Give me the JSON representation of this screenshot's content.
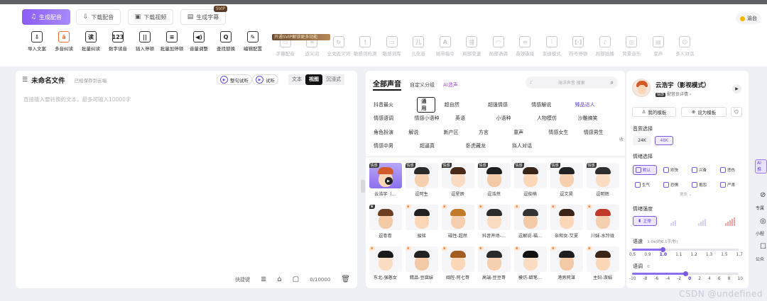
{
  "top_tabs": [
    {
      "label": "生成配音",
      "icon": "♫",
      "active": true
    },
    {
      "label": "下载配音",
      "icon": "⇩"
    },
    {
      "label": "下载视频",
      "icon": "▣"
    },
    {
      "label": "生成字幕",
      "icon": "▤"
    }
  ],
  "svip_tag": "SVIP",
  "user_pill": "渝台",
  "tools": [
    {
      "label": "导入文案",
      "icon": "⇩"
    },
    {
      "label": "多音纠读",
      "icon": "ā"
    },
    {
      "label": "批量纠读",
      "icon": "读"
    },
    {
      "label": "数字读音",
      "icon": "123"
    },
    {
      "label": "插入停顿",
      "icon": "||"
    },
    {
      "label": "批量加停顿",
      "icon": "≡"
    },
    {
      "label": "音量调整",
      "icon": "◀)"
    },
    {
      "label": "查找替换",
      "icon": "Q"
    },
    {
      "label": "编辑配置",
      "icon": "✎"
    }
  ],
  "svip_banner": "开通SVIP解锁更多功能",
  "svip_tools": [
    {
      "label": "字幕配音",
      "icon": "▭"
    },
    {
      "label": "近义词",
      "icon": "≈"
    },
    {
      "label": "全文近义词",
      "icon": "↻"
    },
    {
      "label": "敏感词检测",
      "icon": "!"
    },
    {
      "label": "敏感词库",
      "icon": "▭"
    },
    {
      "label": "儿化音",
      "icon": "儿"
    },
    {
      "label": "插带指令",
      "icon": "A"
    },
    {
      "label": "局部变速",
      "icon": "⇶"
    },
    {
      "label": "局部语调",
      "icon": "◠"
    },
    {
      "label": "音效连接",
      "icon": "∞"
    },
    {
      "label": "变速模式",
      "icon": "⫶"
    },
    {
      "label": "符号停顿",
      "icon": "[·]"
    },
    {
      "label": "局部插播",
      "icon": "♪"
    },
    {
      "label": "背景音乐",
      "icon": "◎"
    },
    {
      "label": "变声",
      "icon": "▤"
    },
    {
      "label": "多人对话",
      "icon": "☺"
    }
  ],
  "editor": {
    "title": "未命名文件",
    "save_status": "已经保存到云端",
    "preview_all": "整句试听",
    "preview": "试听",
    "view_modes": [
      "文本",
      "视图",
      "沉浸式"
    ],
    "active_view": 1,
    "placeholder": "直接输入要转换的文本，最多可输入10000字",
    "footer_shortcut": "快捷键",
    "counter": "0/10000"
  },
  "voice_panel": {
    "tab_all": "全部声音",
    "tab_custom": "自定义分组",
    "tab_ai": "AI造声",
    "search_placeholder": "海洋声音 搜索",
    "collapse": "收",
    "tag_rows": [
      [
        "抖音最火",
        "通用",
        "超自然",
        "超强情感",
        "情感解说",
        "臻品达人"
      ],
      [
        "情感语调",
        "情感小语种",
        "英语",
        "小语种",
        "人物模仿",
        "沙雕搞笑"
      ],
      [
        "角色扮演",
        "解说",
        "新产区",
        "方言",
        "童声",
        "情感女生",
        "情感男生"
      ],
      [
        "情感中男",
        "超逼真",
        "卧虎藏龙",
        "拟人对话"
      ]
    ],
    "voices": [
      {
        "name": "云浩宇（…",
        "badge": "情感",
        "badge_type": "dark",
        "selected": true,
        "hair": "#d35b2a"
      },
      {
        "name": "逗阿生",
        "badge": "情感",
        "badge_type": "dark",
        "hair": "#2b2b2b"
      },
      {
        "name": "逗星辰",
        "badge": "情感",
        "badge_type": "dark",
        "hair": "#4a2a18"
      },
      {
        "name": "逗浩然",
        "badge": "情感",
        "badge_type": "dark",
        "hair": "#1f1f1f"
      },
      {
        "name": "逗俊楠",
        "badge": "情感",
        "badge_type": "dark",
        "hair": "#3a2618"
      },
      {
        "name": "逗文昊",
        "badge": "情感",
        "badge_type": "dark",
        "hair": "#222"
      },
      {
        "name": "逗明辉",
        "badge": "情感",
        "badge_type": "dark",
        "hair": "#2e2e2e"
      },
      {
        "name": "逗卷卷",
        "badge": "♛",
        "badge_type": "dark",
        "hair": "#6b3e1f"
      },
      {
        "name": "骏铭",
        "badge": "♛",
        "badge_type": "crown",
        "hair": "#222"
      },
      {
        "name": "磁性-超然",
        "badge": "♛",
        "badge_type": "crown",
        "hair": "#c07a2a"
      },
      {
        "name": "抖音开场-…",
        "badge": "♛",
        "badge_type": "crown",
        "hair": "#2b2b2b"
      },
      {
        "name": "逗解说-福…",
        "badge": "♛",
        "badge_type": "crown",
        "hair": "#333"
      },
      {
        "name": "亲和女-艾夏",
        "badge": "♛",
        "badge_type": "crown",
        "hair": "#3b2216"
      },
      {
        "name": "川妹-水玲珑",
        "badge": "♛",
        "badge_type": "crown",
        "hair": "#c0392b"
      },
      {
        "name": "东北-强憨女",
        "badge": "♛",
        "badge_type": "crown",
        "hair": "#1a1a1a"
      },
      {
        "name": "精品-豆腐妹",
        "badge": "♛",
        "badge_type": "crown",
        "hair": "#222"
      },
      {
        "name": "闽腔-阿七哥",
        "badge": "♛",
        "badge_type": "crown",
        "hair": "#a35d22"
      },
      {
        "name": "高端-豆豆哥",
        "badge": "♛",
        "badge_type": "crown",
        "hair": "#2a2a2a"
      },
      {
        "name": "模仿-蜡笔…",
        "badge": "♛",
        "badge_type": "crown",
        "hair": "#111"
      },
      {
        "name": "港男阿湛",
        "badge": "♛",
        "badge_type": "crown",
        "hair": "#1e1e1e"
      },
      {
        "name": "主妇-淑娟",
        "badge": "♛",
        "badge_type": "crown",
        "hair": "#3c2416"
      }
    ]
  },
  "detail": {
    "name": "云浩宇（影视模式）",
    "sub": "配音员详情",
    "sub_tag": "情感",
    "my_templates": "我的模板",
    "set_template": "设为模板",
    "quality_label": "音质选择",
    "quality": [
      "24K",
      "48K"
    ],
    "quality_active": 1,
    "emotion_label": "情绪选择",
    "emotions": [
      "默认",
      "欢快",
      "兴奋",
      "悲伤",
      "生气",
      "恐惧",
      "抱怨",
      "严肃"
    ],
    "more": "更多",
    "intensity_label": "情绪强度",
    "intensity_active": "正常",
    "speed_label": "语速",
    "speed_value": "1.0x(约6.1字/秒)",
    "speed_scale": [
      "0.5",
      "0.9",
      "1.0",
      "1.1",
      "1.2",
      "1.3",
      "1.5",
      "1.7"
    ],
    "speed_current": 1.0,
    "pitch_label": "语调",
    "pitch_value": "0",
    "pitch_scale": [
      "-10",
      "-8",
      "-6",
      "-4",
      "-2",
      "0",
      "2",
      "4",
      "6",
      "8",
      "10"
    ],
    "pitch_current": 0
  },
  "side_edge": {
    "ai_tag": "AI推",
    "items": [
      "专属",
      "小程",
      "公众"
    ]
  },
  "watermark": "CSDN @undefined"
}
